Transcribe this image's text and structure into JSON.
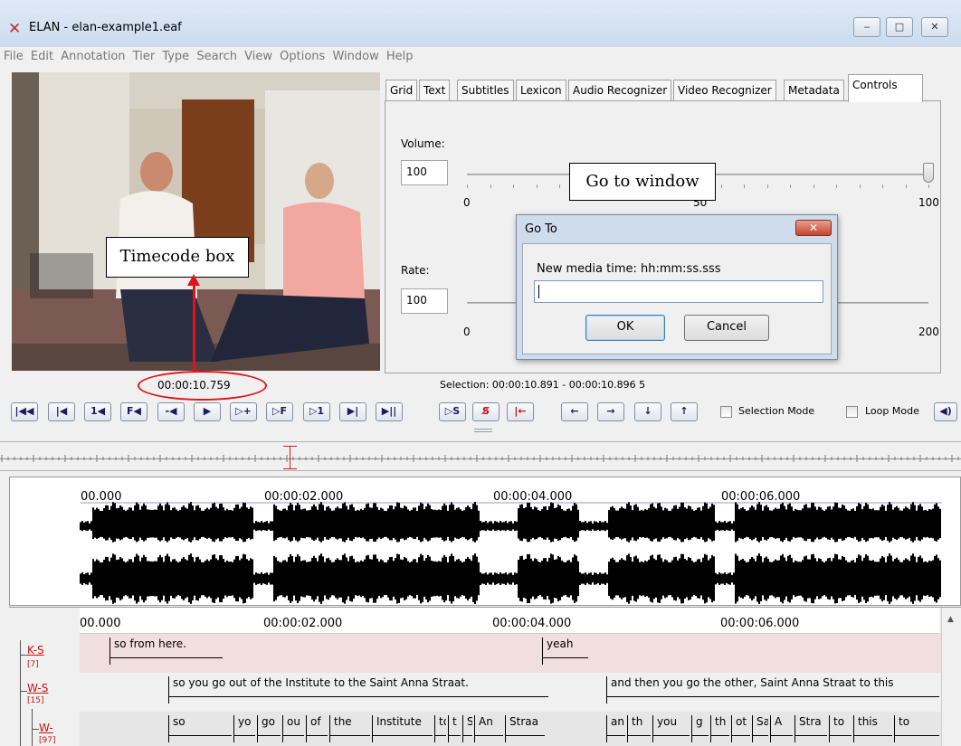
{
  "window": {
    "title": "ELAN - elan-example1.eaf",
    "controls": [
      "‒",
      "□",
      "✕"
    ]
  },
  "menu": [
    "File",
    "Edit",
    "Annotation",
    "Tier",
    "Type",
    "Search",
    "View",
    "Options",
    "Window",
    "Help"
  ],
  "tabs": [
    "Grid",
    "Text",
    "Subtitles",
    "Lexicon",
    "Audio Recognizer",
    "Video Recognizer",
    "Metadata",
    "Controls"
  ],
  "controls_panel": {
    "volume_label": "Volume:",
    "volume_value": "100",
    "volume_level": 1.0,
    "volume_scale": [
      "0",
      "50",
      "100"
    ],
    "rate_label": "Rate:",
    "rate_value": "100",
    "rate_scale": [
      "0",
      "200"
    ]
  },
  "goto_dialog": {
    "title": "Go To",
    "close": "✕",
    "prompt": "New media time: hh:mm:ss.sss",
    "value": "",
    "ok": "OK",
    "cancel": "Cancel"
  },
  "callouts": {
    "goto": "Go to window",
    "timecode": "Timecode box"
  },
  "timecode": "00:00:10.759",
  "selection": "Selection: 00:00:10.891 - 00:00:10.896  5",
  "player_buttons": [
    "|◀◀",
    "|◀",
    "1◀",
    "F◀",
    "-◀",
    "▶",
    "▷+",
    "▷F",
    "▷1",
    "▶|",
    "▶||"
  ],
  "selection_buttons": [
    "▷S",
    "S̸",
    "|←"
  ],
  "nav_buttons": [
    "←",
    "→",
    "↓",
    "↑"
  ],
  "modes": {
    "selection": "Selection Mode",
    "loop": "Loop Mode"
  },
  "timeline": {
    "labels": [
      "00.000",
      "00:00:02.000",
      "00:00:04.000",
      "00:00:06.000"
    ]
  },
  "tiers": [
    {
      "name": "K-S",
      "count": "[7]",
      "color": "#d01010"
    },
    {
      "name": "W-S",
      "count": "[15]",
      "color": "#d01010"
    },
    {
      "name": "W-",
      "count": "[97]",
      "color": "#d01010"
    }
  ],
  "annotations": {
    "ks": [
      "so from here.",
      "yeah"
    ],
    "ws": [
      "so you go out of the Institute to the Saint Anna Straat.",
      "and then you go the other, Saint Anna Straat to this"
    ],
    "w": [
      "so",
      "yo",
      "go",
      "ou",
      "of",
      "the",
      "Institute",
      "to",
      "t",
      "S",
      "An",
      "Straa",
      "an",
      "th",
      "you",
      "g",
      "th",
      "ot",
      "Sa",
      "A",
      "Stra",
      "to",
      "this",
      "to"
    ]
  }
}
